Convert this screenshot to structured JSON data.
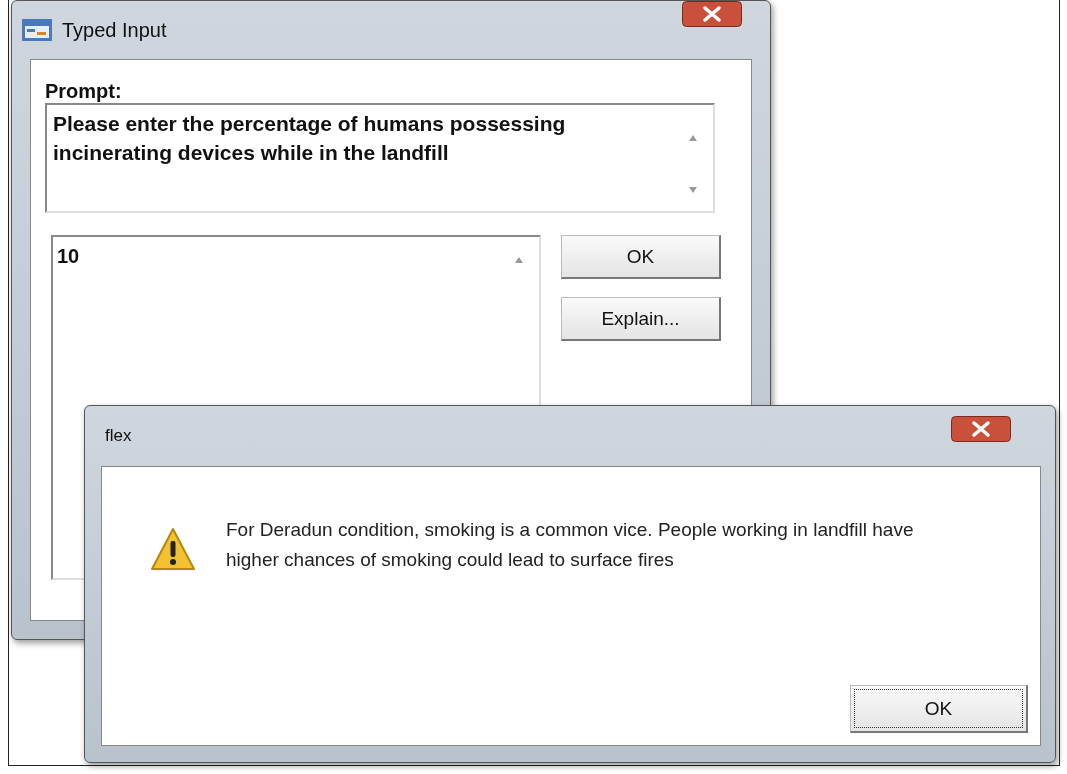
{
  "main_window": {
    "title": "Typed Input",
    "prompt_label": "Prompt:",
    "prompt_text": "Please enter the percentage of humans possessing incinerating devices while in the landfill",
    "answer": "10",
    "buttons": [
      {
        "label": "OK",
        "focused": false
      },
      {
        "label": "Explain...",
        "focused": false
      }
    ]
  },
  "dialog": {
    "title": "flex",
    "message": "For Deradun condition, smoking is a common vice. People working in landfill have higher chances of smoking could lead to surface fires",
    "buttons": [
      {
        "label": "OK",
        "focused": true
      }
    ]
  }
}
